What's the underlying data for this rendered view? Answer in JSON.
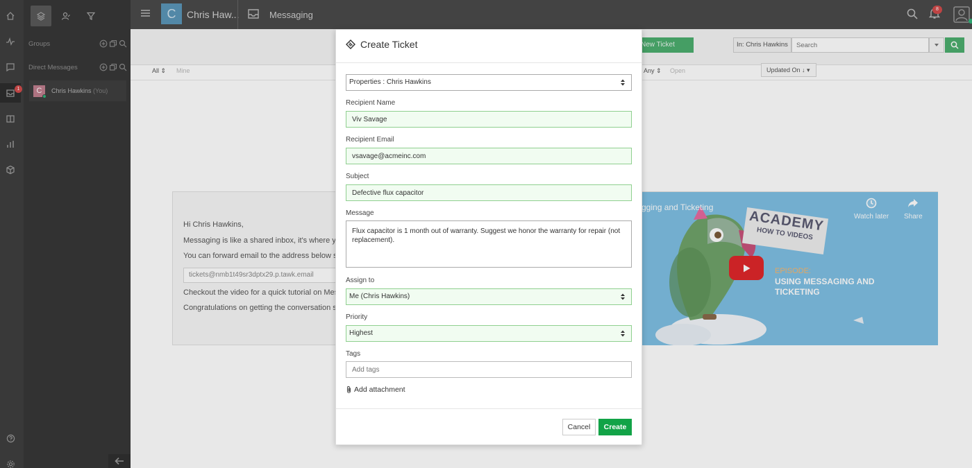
{
  "rail": {
    "inbox_badge": "1",
    "items": [
      "home-icon",
      "activity-icon",
      "chat-icon",
      "inbox-icon",
      "book-icon",
      "reports-icon",
      "addons-icon",
      "help-icon",
      "settings-icon"
    ]
  },
  "sidepanel": {
    "groups_title": "Groups",
    "dm_title": "Direct Messages",
    "dm_items": [
      {
        "initial": "C",
        "name": "Chris Hawkins",
        "suffix": "(You)"
      }
    ]
  },
  "topbar": {
    "user_initial": "C",
    "user_name": "Chris Haw...",
    "page_title": "Messaging",
    "bell_badge": "8"
  },
  "toolbar": {
    "new_ticket_label": "New Ticket",
    "in_label": "In: Chris Hawkins",
    "search_placeholder": "Search",
    "filter_all": "All",
    "filter_mine": "Mine",
    "filter_any": "Any",
    "filter_open": "Open",
    "updated_on": "Updated On"
  },
  "welcome": {
    "greeting": "Hi Chris Hawkins,",
    "line1": "Messaging is like a shared inbox, it's where yo",
    "line2": "You can forward email to the address below s",
    "email": "tickets@nmb1t49sr3dptx29.p.tawk.email",
    "line3": "Checkout the video for a quick tutorial on Mes",
    "line4": "Congratulations on getting the conversation s"
  },
  "video": {
    "title": "gging and Ticketing",
    "watch_later": "Watch later",
    "share": "Share",
    "academy": "ACADEMY",
    "academy_sub": "HOW TO VIDEOS",
    "episode": "EPISODE:",
    "episode_title": "USING MESSAGING AND TICKETING"
  },
  "modal": {
    "title": "Create Ticket",
    "properties_value": "Properties : Chris Hawkins",
    "recipient_name_label": "Recipient Name",
    "recipient_name_value": "Viv Savage",
    "recipient_email_label": "Recipient Email",
    "recipient_email_value": "vsavage@acmeinc.com",
    "subject_label": "Subject",
    "subject_value": "Defective flux capacitor",
    "message_label": "Message",
    "message_value": "Flux capacitor is 1 month out of warranty. Suggest we honor the warranty for repair (not replacement).",
    "assign_label": "Assign to",
    "assign_value": "Me (Chris Hawkins)",
    "priority_label": "Priority",
    "priority_value": "Highest",
    "tags_label": "Tags",
    "tags_placeholder": "Add tags",
    "attachment_label": "Add attachment",
    "cancel_label": "Cancel",
    "create_label": "Create"
  },
  "colors": {
    "accent_green": "#12a347",
    "valid_border": "#8fcf8f",
    "valid_bg": "#f1fcf1",
    "badge_red": "#d24b4b"
  }
}
